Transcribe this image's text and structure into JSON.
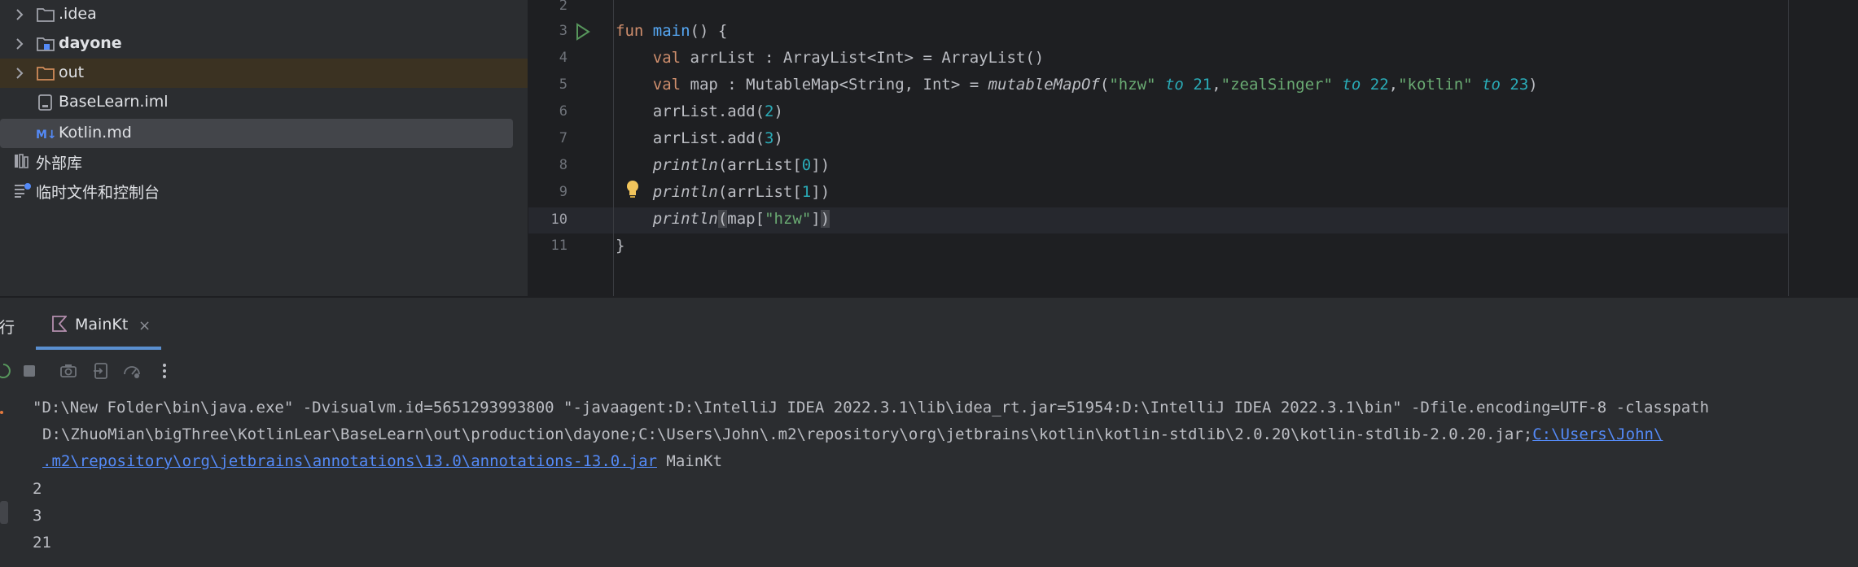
{
  "project_tree": {
    "items": [
      {
        "label": ".idea",
        "icon": "folder-icon",
        "expandable": true
      },
      {
        "label": "dayone",
        "icon": "module-folder-icon",
        "expandable": true
      },
      {
        "label": "out",
        "icon": "excluded-folder-icon",
        "expandable": true
      },
      {
        "label": "BaseLearn.iml",
        "icon": "iml-file-icon",
        "expandable": false
      },
      {
        "label": "Kotlin.md",
        "icon": "markdown-file-icon",
        "expandable": false
      }
    ],
    "external_libraries": "外部库",
    "scratches": "临时文件和控制台"
  },
  "editor": {
    "line_numbers": [
      "2",
      "3",
      "4",
      "5",
      "6",
      "7",
      "8",
      "9",
      "10",
      "11"
    ],
    "current_line": "10"
  },
  "run_panel": {
    "title": "运行",
    "tab_label": "MainKt",
    "tab_close": "×",
    "console": {
      "cmd_line1": "\"D:\\New Folder\\bin\\java.exe\" -Dvisualvm.id=5651293993800 \"-javaagent:D:\\IntelliJ IDEA 2022.3.1\\lib\\idea_rt.jar=51954:D:\\IntelliJ IDEA 2022.3.1\\bin\" -Dfile.encoding=UTF-8 -classpath",
      "cmd_line2": "D:\\ZhuoMian\\bigThree\\KotlinLear\\BaseLearn\\out\\production\\dayone;C:\\Users\\John\\.m2\\repository\\org\\jetbrains\\kotlin\\kotlin-stdlib\\2.0.20\\kotlin-stdlib-2.0.20.jar;",
      "cmd_line2_link": "C:\\Users\\John\\",
      "cmd_line3_link": ".m2\\repository\\org\\jetbrains\\annotations\\13.0\\annotations-13.0.jar",
      "cmd_line3_tail": " MainKt",
      "output": [
        "2",
        "3",
        "21"
      ]
    }
  },
  "colors": {
    "keyword": "#cf8e6d",
    "function": "#56a8f5",
    "string": "#6aab73",
    "number": "#2aacb8",
    "link": "#548af7"
  }
}
